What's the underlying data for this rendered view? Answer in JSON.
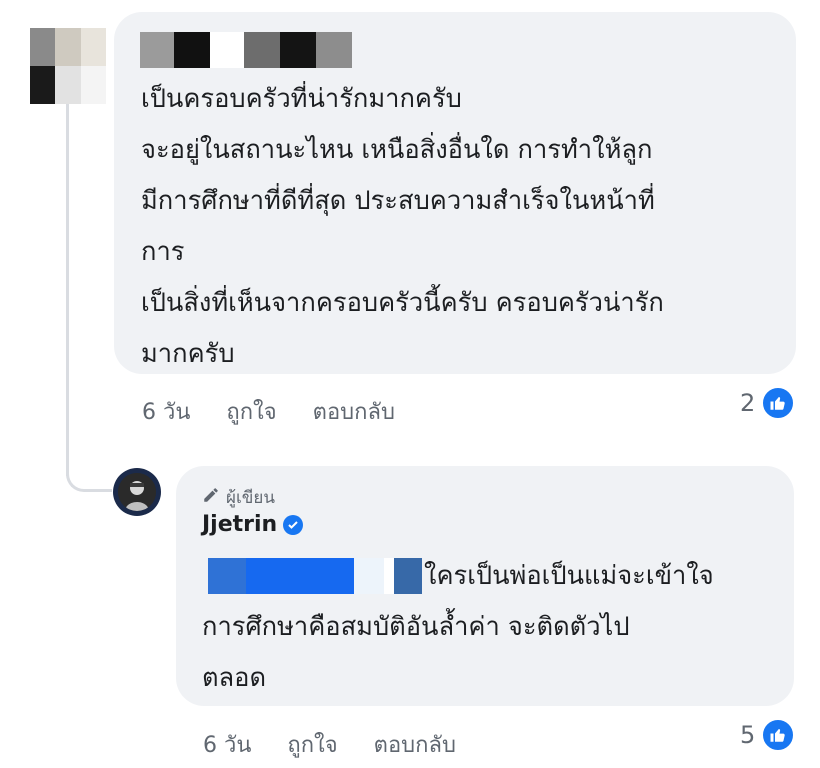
{
  "comment": {
    "text": "เป็นครอบครัวที่น่ารักมากครับ\nจะอยู่ในสถานะไหน  เหนือสิ่งอื่นใด การทำให้ลูก\nมีการศึกษาที่ดีที่สุด ประสบความสำเร็จในหน้าที่\nการ\nเป็นสิ่งที่เห็นจากครอบครัวนี้ครับ ครอบครัวน่ารัก\nมากครับ",
    "time": "6 วัน",
    "like_label": "ถูกใจ",
    "reply_label": "ตอบกลับ",
    "reaction_count": "2"
  },
  "reply": {
    "author_tag": "ผู้เขียน",
    "author_name": "Jjetrin",
    "line1": "ใครเป็นพ่อเป็นแม่จะเข้าใจ",
    "text_rest": "การศึกษาคือสมบัติอันล้ำค่า จะติดตัวไป\nตลอด",
    "time": "6 วัน",
    "like_label": "ถูกใจ",
    "reply_label": "ตอบกลับ",
    "reaction_count": "5"
  },
  "icons": {
    "reaction": "like-thumb-icon",
    "author_tag": "pencil-icon",
    "verified": "verified-badge-icon"
  },
  "colors": {
    "bubble": "#f0f2f5",
    "text": "#1c1e21",
    "meta": "#606770",
    "accent": "#1877f2"
  }
}
